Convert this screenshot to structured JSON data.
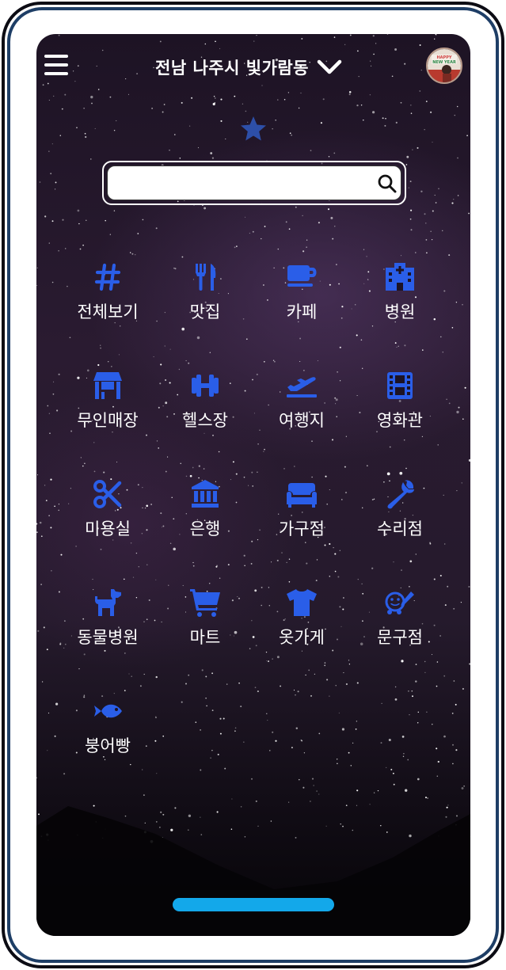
{
  "header": {
    "location": "전남 나주시 빛가람동",
    "menu_icon": "hamburger-menu-icon",
    "dropdown_icon": "chevron-down-icon",
    "avatar_text": "HAPPY NEW YEAR"
  },
  "favorite": {
    "icon": "star-icon",
    "color": "#2d4fa8"
  },
  "search": {
    "value": "",
    "placeholder": "",
    "icon": "search-icon"
  },
  "categories": [
    {
      "label": "전체보기",
      "icon": "hashtag-icon"
    },
    {
      "label": "맛집",
      "icon": "utensils-icon"
    },
    {
      "label": "카페",
      "icon": "coffee-cup-icon"
    },
    {
      "label": "병원",
      "icon": "hospital-icon"
    },
    {
      "label": "무인매장",
      "icon": "store-icon"
    },
    {
      "label": "헬스장",
      "icon": "dumbbell-icon"
    },
    {
      "label": "여행지",
      "icon": "plane-departure-icon"
    },
    {
      "label": "영화관",
      "icon": "film-icon"
    },
    {
      "label": "미용실",
      "icon": "scissors-icon"
    },
    {
      "label": "은행",
      "icon": "bank-icon"
    },
    {
      "label": "가구점",
      "icon": "couch-icon"
    },
    {
      "label": "수리점",
      "icon": "wrench-icon"
    },
    {
      "label": "동물병원",
      "icon": "dog-icon"
    },
    {
      "label": "마트",
      "icon": "shopping-cart-icon"
    },
    {
      "label": "옷가게",
      "icon": "shirt-icon"
    },
    {
      "label": "문구점",
      "icon": "stationery-icon"
    },
    {
      "label": "붕어빵",
      "icon": "fish-icon"
    }
  ],
  "colors": {
    "accent": "#2a5ee8",
    "home_indicator": "#13a8ea",
    "frame_border": "#1e3e66"
  }
}
